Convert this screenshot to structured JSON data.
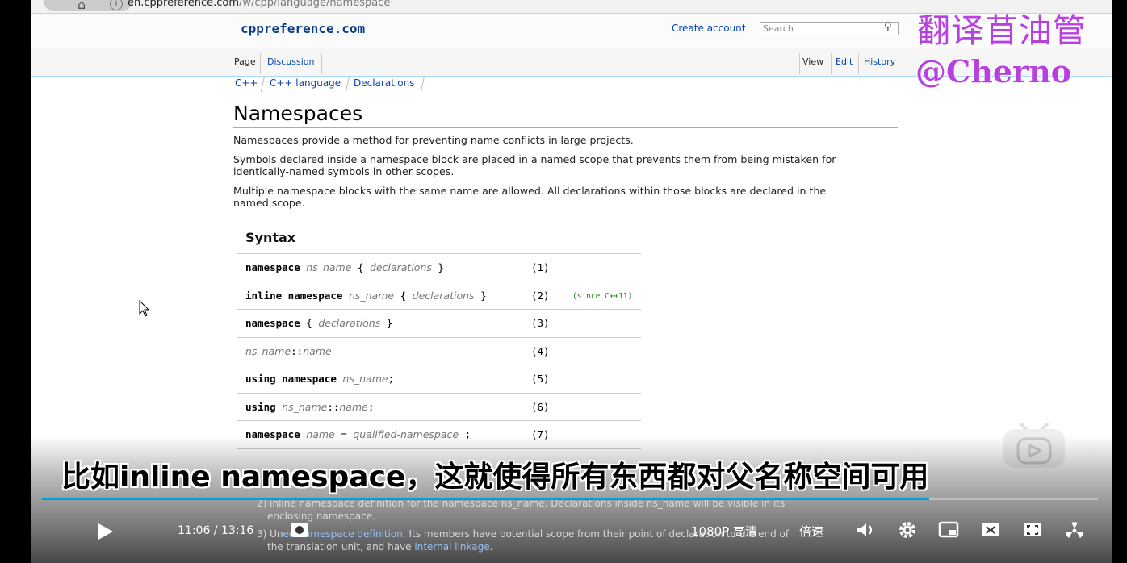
{
  "browser": {
    "url_host": "en.cppreference.com",
    "url_path": "/w/cpp/language/namespace"
  },
  "site": {
    "logo": "cppreference.com",
    "create_account": "Create account",
    "search_placeholder": "Search"
  },
  "tabs": {
    "left": [
      "Page",
      "Discussion"
    ],
    "right": [
      "View",
      "Edit",
      "History"
    ]
  },
  "breadcrumbs": [
    "C++",
    "C++ language",
    "Declarations"
  ],
  "article": {
    "title": "Namespaces",
    "paragraphs": [
      "Namespaces provide a method for preventing name conflicts in large projects.",
      "Symbols declared inside a namespace block are placed in a named scope that prevents them from being mistaken for",
      "identically-named symbols in other scopes.",
      "Multiple namespace blocks with the same name are allowed. All declarations within those blocks are declared in the",
      "named scope."
    ],
    "syntax_heading": "Syntax",
    "syntax_rows": [
      {
        "parts": [
          [
            "b",
            "namespace"
          ],
          [
            "t",
            " "
          ],
          [
            "i",
            "ns_name"
          ],
          [
            "t",
            " { "
          ],
          [
            "i",
            "declarations"
          ],
          [
            "t",
            " }"
          ]
        ],
        "num": "(1)",
        "note": ""
      },
      {
        "parts": [
          [
            "b",
            "inline namespace"
          ],
          [
            "t",
            " "
          ],
          [
            "i",
            "ns_name"
          ],
          [
            "t",
            " { "
          ],
          [
            "i",
            "declarations"
          ],
          [
            "t",
            " }"
          ]
        ],
        "num": "(2)",
        "note": "(since C++11)"
      },
      {
        "parts": [
          [
            "b",
            "namespace"
          ],
          [
            "t",
            " { "
          ],
          [
            "i",
            "declarations"
          ],
          [
            "t",
            " }"
          ]
        ],
        "num": "(3)",
        "note": ""
      },
      {
        "parts": [
          [
            "i",
            "ns_name"
          ],
          [
            "t",
            "::"
          ],
          [
            "i",
            "name"
          ]
        ],
        "num": "(4)",
        "note": ""
      },
      {
        "parts": [
          [
            "b",
            "using namespace"
          ],
          [
            "t",
            " "
          ],
          [
            "i",
            "ns_name"
          ],
          [
            "t",
            ";"
          ]
        ],
        "num": "(5)",
        "note": ""
      },
      {
        "parts": [
          [
            "b",
            "using"
          ],
          [
            "t",
            " "
          ],
          [
            "i",
            "ns_name"
          ],
          [
            "t",
            "::"
          ],
          [
            "i",
            "name"
          ],
          [
            "t",
            ";"
          ]
        ],
        "num": "(6)",
        "note": ""
      },
      {
        "parts": [
          [
            "b",
            "namespace"
          ],
          [
            "t",
            " "
          ],
          [
            "i",
            "name"
          ],
          [
            "t",
            " = "
          ],
          [
            "i",
            "qualified-namespace"
          ],
          [
            "t",
            " ;"
          ]
        ],
        "num": "(7)",
        "note": ""
      }
    ],
    "below": {
      "line1": "2) inline namespace definition for the namespace ns_name. Declarations inside ns_name will be visible in its",
      "line2": "enclosing namespace.",
      "line3_pre": "3) Un",
      "line3_link": "ed namespace definition",
      "line3_post": ". Its members have potential scope from their point of declaration to the end of",
      "line4_pre": "the translation unit, and have ",
      "line4_link": "internal linkage",
      "line4_post": "."
    }
  },
  "watermark": {
    "line1": "翻译苜油管",
    "line2": "@Cherno"
  },
  "player": {
    "subtitle": "比如inline namespace，这就使得所有东西都对父名称空间可用",
    "time_current": "11:06",
    "time_total": "13:16",
    "progress": 0.84,
    "quality": "1080P 高清",
    "speed": "倍速",
    "accent": "#00a1d6"
  }
}
